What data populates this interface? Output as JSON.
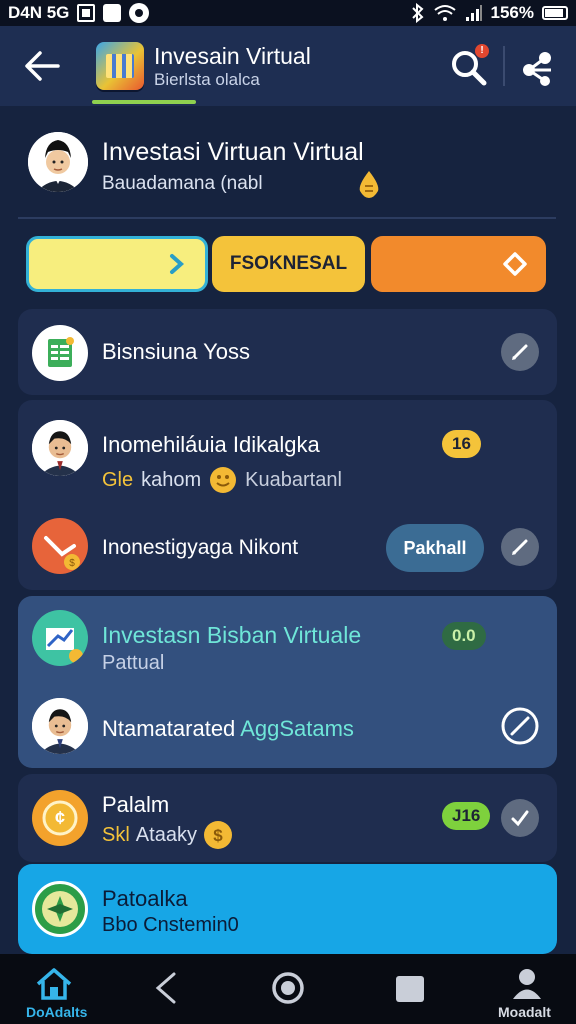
{
  "status_bar": {
    "left_text": "D4N 5G",
    "right_text": "156%"
  },
  "app_bar": {
    "title": "Invesain Virtual",
    "subtitle": "Bierlsta olalca"
  },
  "profile": {
    "name": "Investasi Virtuan Virtual",
    "subtitle": "Bauadamana (nabl"
  },
  "action_pills": {
    "middle_label": "FSOKNESAL"
  },
  "cards": [
    {
      "title": "Bisnsiuna Yoss"
    },
    {
      "title": "Inomehiláuia Idikalgka",
      "badge": "16",
      "sub_prefix": "Gle",
      "sub_main": "kahom",
      "sub_suffix": "Kuabartanl",
      "row2_title": "Inonestigyaga Nikont",
      "row2_button": "Pakhall"
    },
    {
      "title": "Investasn Bisban Virtuale",
      "subtitle": "Pattual",
      "badge": "0.0",
      "row2_title_main": "Ntamatarated",
      "row2_title_accent": "AggSatams"
    },
    {
      "title": "Palalm",
      "sub_prefix": "Skl",
      "sub_main": "Ataaky",
      "badge": "J16"
    },
    {
      "title": "Patoalka",
      "subtitle": "Bbo Cnstemin0"
    }
  ],
  "bottom_nav": {
    "home_label": "DoAdalts",
    "profile_label": "Moadalt"
  },
  "colors": {
    "background": "#16233f",
    "card": "#1f2d4f",
    "card_highlight": "#33507e",
    "card_blue": "#17a6e6",
    "accent_yellow": "#f4c33a",
    "accent_orange": "#f28a2c",
    "teal_text": "#6fe6d8"
  },
  "icons": [
    "back-arrow-icon",
    "app-logo",
    "search-icon",
    "share-icon",
    "gold-drop-icon",
    "chevron-right-icon",
    "diamond-icon",
    "spreadsheet-icon",
    "edit-icon",
    "coin-icon",
    "chart-icon",
    "slash-icon",
    "home-icon",
    "back-icon",
    "circle-home-icon",
    "recents-icon",
    "profile-icon"
  ]
}
